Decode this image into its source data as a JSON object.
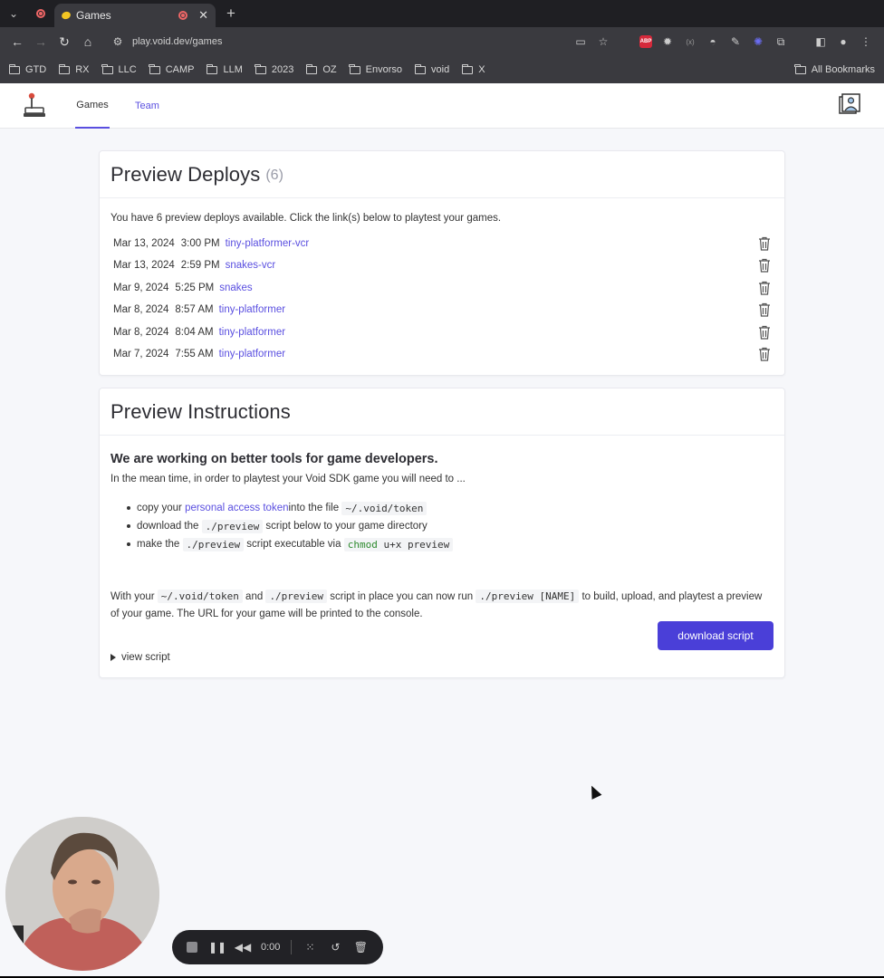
{
  "browser": {
    "tab_title": "Games",
    "url": "play.void.dev/games",
    "bookmarks": [
      "GTD",
      "RX",
      "LLC",
      "CAMP",
      "LLM",
      "2023",
      "OZ",
      "Envorso",
      "void",
      "X"
    ],
    "all_bookmarks": "All Bookmarks"
  },
  "nav": {
    "tabs": [
      "Games",
      "Team"
    ],
    "active_tab": "Games"
  },
  "deploys": {
    "title": "Preview Deploys",
    "count": "(6)",
    "intro": "You have 6 preview deploys available. Click the link(s) below to playtest your games.",
    "rows": [
      {
        "date": "Mar 13, 2024",
        "time": "3:00 PM",
        "name": "tiny-platformer-vcr"
      },
      {
        "date": "Mar 13, 2024",
        "time": "2:59 PM",
        "name": "snakes-vcr"
      },
      {
        "date": "Mar 9, 2024",
        "time": "5:25 PM",
        "name": "snakes"
      },
      {
        "date": "Mar 8, 2024",
        "time": "8:57 AM",
        "name": "tiny-platformer"
      },
      {
        "date": "Mar 8, 2024",
        "time": "8:04 AM",
        "name": "tiny-platformer"
      },
      {
        "date": "Mar 7, 2024",
        "time": "7:55 AM",
        "name": "tiny-platformer"
      }
    ]
  },
  "instructions": {
    "title": "Preview Instructions",
    "heading": "We are working on better tools for game developers.",
    "sub": "In the mean time, in order to playtest your Void SDK game you will need to ...",
    "step1_pre": "copy your ",
    "step1_link": "personal access token",
    "step1_mid": "into the file ",
    "step1_code": "~/.void/token",
    "step2_pre": "download the ",
    "step2_code": "./preview",
    "step2_post": " script below to your game directory",
    "step3_pre": "make the ",
    "step3_code": "./preview",
    "step3_mid": " script executable via ",
    "step3_cmd": "chmod",
    "step3_cmd_rest": " u+x preview",
    "para_1": "With your ",
    "para_code1": "~/.void/token",
    "para_2": " and ",
    "para_code2": "./preview",
    "para_3": " script in place you can now run ",
    "para_code3": "./preview [NAME]",
    "para_4": " to build, upload, and playtest a preview of your game. The URL for your game will be printed to the console.",
    "download_label": "download script",
    "view_script_label": "view script"
  },
  "recorder": {
    "time": "0:00"
  },
  "colors": {
    "accent": "#5a4fe0",
    "button": "#4a3fd8",
    "page_bg": "#f6f7fa"
  }
}
